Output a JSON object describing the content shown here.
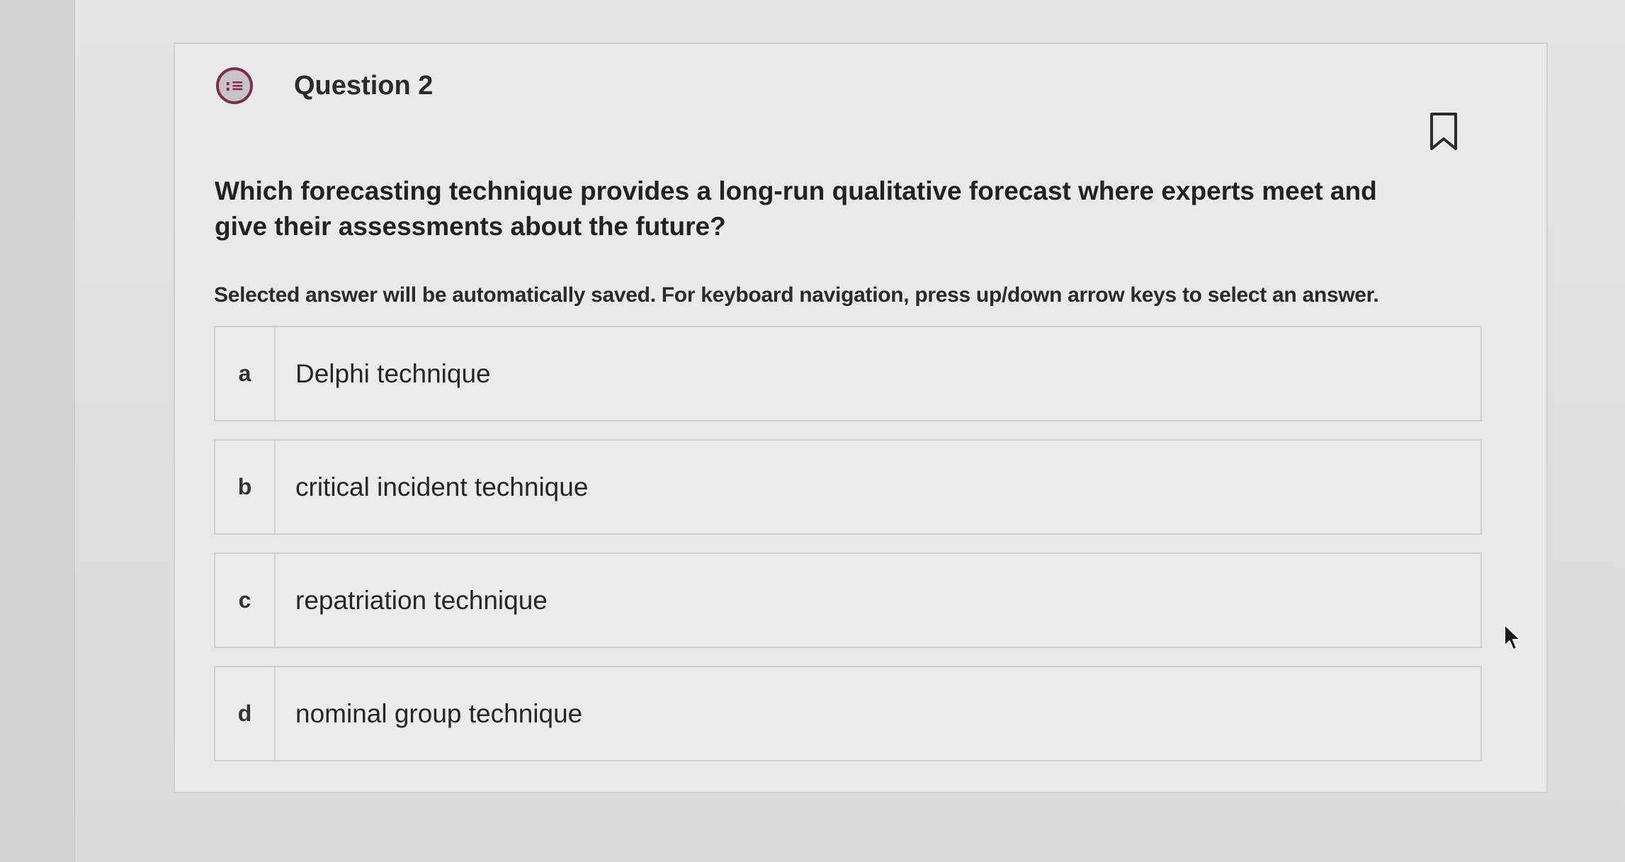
{
  "question": {
    "title": "Question 2",
    "icon": "list-bubble-icon",
    "icon_glyph": ":≡",
    "text": "Which forecasting technique provides a long-run qualitative forecast where experts meet and give their assessments about the future?",
    "instructions": "Selected answer will be automatically saved. For keyboard navigation, press up/down arrow keys to select an answer."
  },
  "answers": [
    {
      "letter": "a",
      "label": "Delphi technique"
    },
    {
      "letter": "b",
      "label": "critical incident technique"
    },
    {
      "letter": "c",
      "label": "repatriation technique"
    },
    {
      "letter": "d",
      "label": "nominal group technique"
    }
  ],
  "colors": {
    "accent": "#7a2f4d",
    "background": "#dcdcdc",
    "card": "#e9e9e9"
  }
}
